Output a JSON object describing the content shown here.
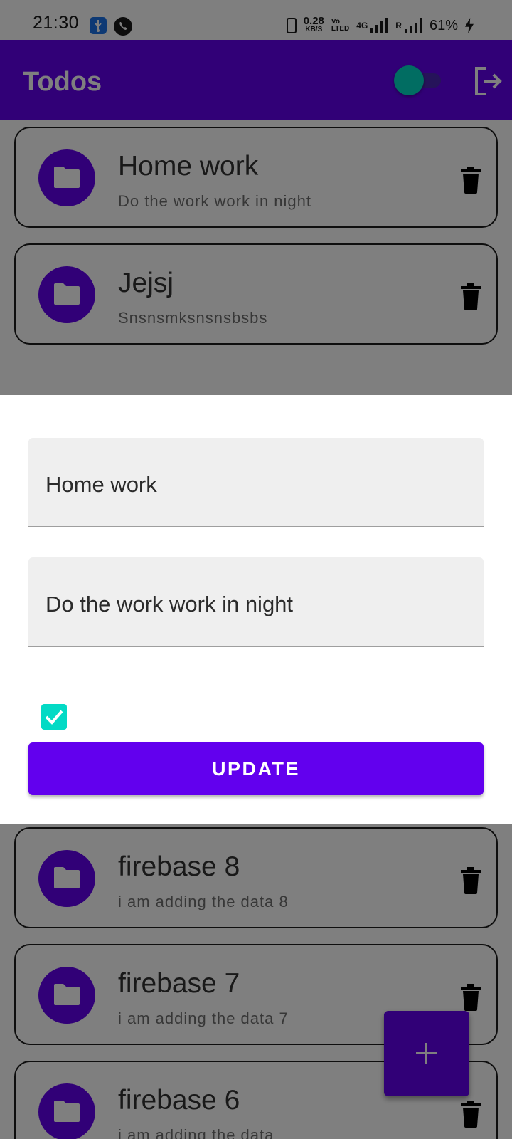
{
  "status_bar": {
    "time": "21:30",
    "net_speed_value": "0.28",
    "net_speed_unit": "KB/S",
    "volte_top": "Vo",
    "volte_bottom": "LTED",
    "network_type": "4G",
    "roaming_label": "R",
    "battery": "61%",
    "icons": [
      "usb-icon",
      "call-icon",
      "vibrate-icon",
      "signal-icon",
      "charging-icon"
    ]
  },
  "app_bar": {
    "title": "Todos",
    "theme_toggle_on": true,
    "icons": [
      "logout-icon"
    ]
  },
  "todos": [
    {
      "title": "Home work",
      "description": "Do the work work in night"
    },
    {
      "title": "Jejsj",
      "description": "Snsnsmksnsnsbsbs"
    },
    {
      "title": "firebase 8",
      "description": "i am adding the data 8"
    },
    {
      "title": "firebase 7",
      "description": "i am adding the data 7"
    },
    {
      "title": "firebase 6",
      "description": "i am adding the data"
    }
  ],
  "list_icons": [
    "folder-icon",
    "delete-icon"
  ],
  "fab": {
    "icon": "plus-icon"
  },
  "edit_dialog": {
    "title_value": "Home work",
    "description_value": "Do the work work in night",
    "completed_checked": true,
    "update_label": "UPDATE"
  },
  "colors": {
    "primary": "#6200ee",
    "secondary": "#03dac5",
    "scrim": "rgba(0,0,0,0.5)"
  }
}
